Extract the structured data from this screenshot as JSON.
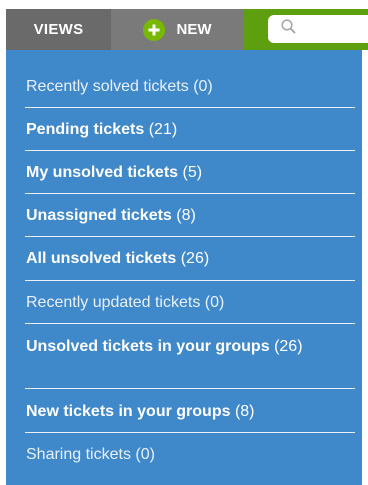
{
  "toolbar": {
    "views_label": "VIEWS",
    "new_label": "NEW",
    "search_placeholder": ""
  },
  "views": [
    {
      "name": "Recently solved tickets",
      "count": "(0)",
      "bold": false
    },
    {
      "name": "Pending tickets",
      "count": "(21)",
      "bold": true
    },
    {
      "name": "My unsolved tickets",
      "count": "(5)",
      "bold": true
    },
    {
      "name": "Unassigned tickets",
      "count": "(8)",
      "bold": true
    },
    {
      "name": "All unsolved tickets",
      "count": "(26)",
      "bold": true
    },
    {
      "name": "Recently updated tickets",
      "count": "(0)",
      "bold": false
    },
    {
      "name": "Unsolved tickets in your groups",
      "count": "(26)",
      "bold": true
    },
    {
      "name": "New tickets in your groups",
      "count": "(8)",
      "bold": true
    },
    {
      "name": "Sharing tickets",
      "count": "(0)",
      "bold": false
    }
  ],
  "colors": {
    "panel": "#3f88c9",
    "views_tab": "#6a6a6a",
    "new_tab": "#7a7a7a",
    "topbar_green": "#5e9f0f",
    "plus_green": "#78b800"
  },
  "icons": {
    "new": "plus-circle-icon",
    "search": "magnifier-icon"
  }
}
